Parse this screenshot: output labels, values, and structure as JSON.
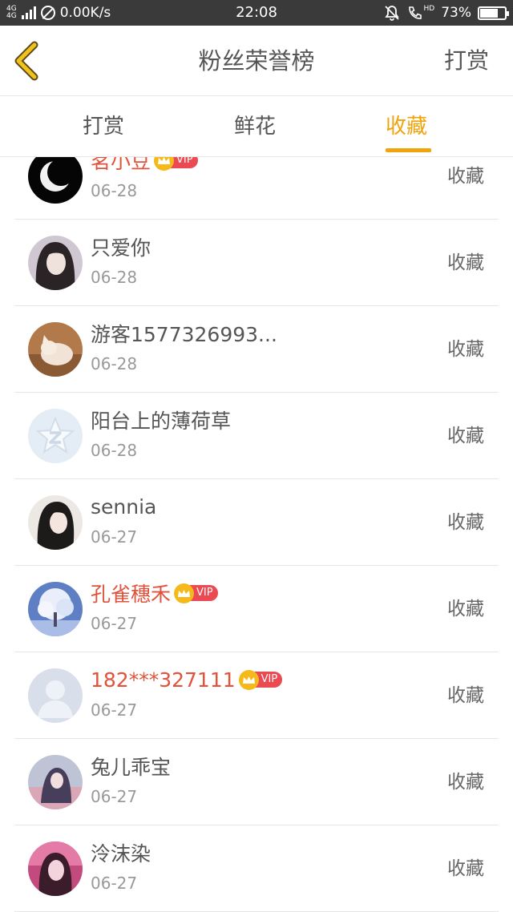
{
  "status_bar": {
    "network": "4G",
    "network2": "4G",
    "speed": "0.00K/s",
    "time": "22:08",
    "hd": "HD",
    "battery": "73%",
    "battery_level": 0.73,
    "icons": [
      "signal-icon",
      "no-sim-icon",
      "mute-icon",
      "volte-call-icon",
      "battery-icon"
    ]
  },
  "header": {
    "title": "粉丝荣誉榜",
    "action": "打赏",
    "back_icon": "chevron-left-icon",
    "accent": "#f0a30a"
  },
  "tabs": [
    {
      "label": "打赏",
      "active": false
    },
    {
      "label": "鲜花",
      "active": false
    },
    {
      "label": "收藏",
      "active": true
    }
  ],
  "list": {
    "vip_badge_text": "VIP",
    "items": [
      {
        "name": "茗小豆",
        "vip": true,
        "date": "06-28",
        "action": "收藏",
        "avatar": "black-moon-avatar"
      },
      {
        "name": "只爱你",
        "vip": false,
        "date": "06-28",
        "action": "收藏",
        "avatar": "girl-photo-avatar"
      },
      {
        "name": "游客1577326993...",
        "vip": false,
        "date": "06-28",
        "action": "收藏",
        "avatar": "cat-photo-avatar"
      },
      {
        "name": "阳台上的薄荷草",
        "vip": false,
        "date": "06-28",
        "action": "收藏",
        "avatar": "default-star-avatar"
      },
      {
        "name": "sennia",
        "vip": false,
        "date": "06-27",
        "action": "收藏",
        "avatar": "woman-photo-avatar"
      },
      {
        "name": "孔雀穗禾",
        "vip": true,
        "date": "06-27",
        "action": "收藏",
        "avatar": "snow-tree-avatar"
      },
      {
        "name": "182***327111",
        "vip": true,
        "date": "06-27",
        "action": "收藏",
        "avatar": "default-person-avatar"
      },
      {
        "name": "兔儿乖宝",
        "vip": false,
        "date": "06-27",
        "action": "收藏",
        "avatar": "anime-photo-avatar"
      },
      {
        "name": "泠沫染",
        "vip": false,
        "date": "06-27",
        "action": "收藏",
        "avatar": "pink-photo-avatar"
      }
    ]
  }
}
